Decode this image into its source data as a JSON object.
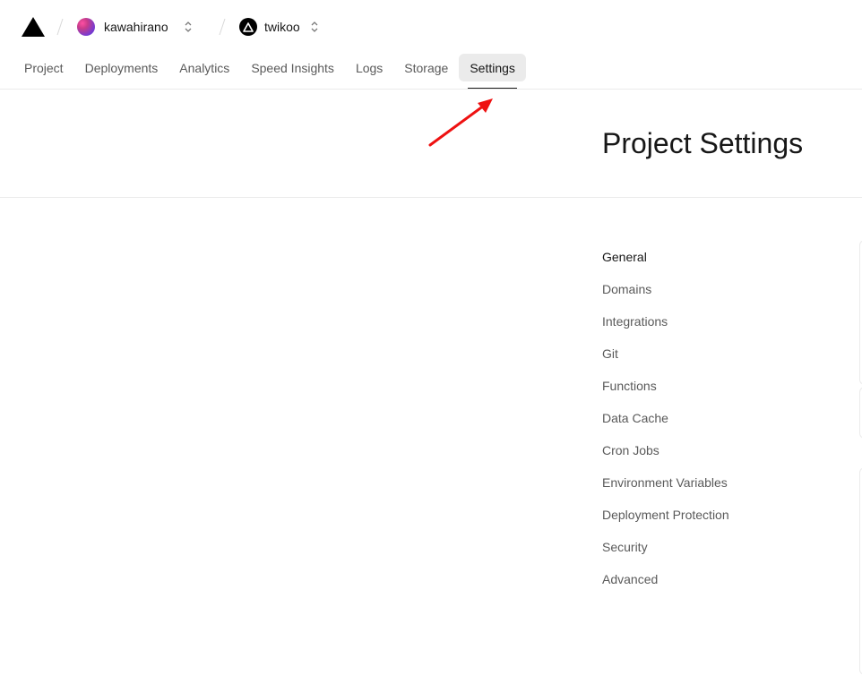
{
  "header": {
    "team_name": "kawahirano",
    "project_name": "twikoo"
  },
  "nav": {
    "tabs": [
      {
        "label": "Project"
      },
      {
        "label": "Deployments"
      },
      {
        "label": "Analytics"
      },
      {
        "label": "Speed Insights"
      },
      {
        "label": "Logs"
      },
      {
        "label": "Storage"
      },
      {
        "label": "Settings",
        "active": true
      }
    ]
  },
  "page": {
    "title": "Project Settings"
  },
  "settings_menu": {
    "items": [
      {
        "label": "General",
        "active": true
      },
      {
        "label": "Domains"
      },
      {
        "label": "Integrations"
      },
      {
        "label": "Git"
      },
      {
        "label": "Functions"
      },
      {
        "label": "Data Cache"
      },
      {
        "label": "Cron Jobs"
      },
      {
        "label": "Environment Variables"
      },
      {
        "label": "Deployment Protection"
      },
      {
        "label": "Security"
      },
      {
        "label": "Advanced"
      }
    ]
  },
  "colors": {
    "annotation_arrow": "#ee1111",
    "active_tab_bg": "#ebebeb",
    "text_primary": "#171717",
    "text_secondary": "#5a5a5a"
  },
  "icons": {
    "logo": "vercel-triangle-icon",
    "team_switcher": "chevron-up-down-icon",
    "project_logo": "project-triangle-icon",
    "project_switcher": "chevron-up-down-icon",
    "annotation": "red-arrow-icon"
  }
}
